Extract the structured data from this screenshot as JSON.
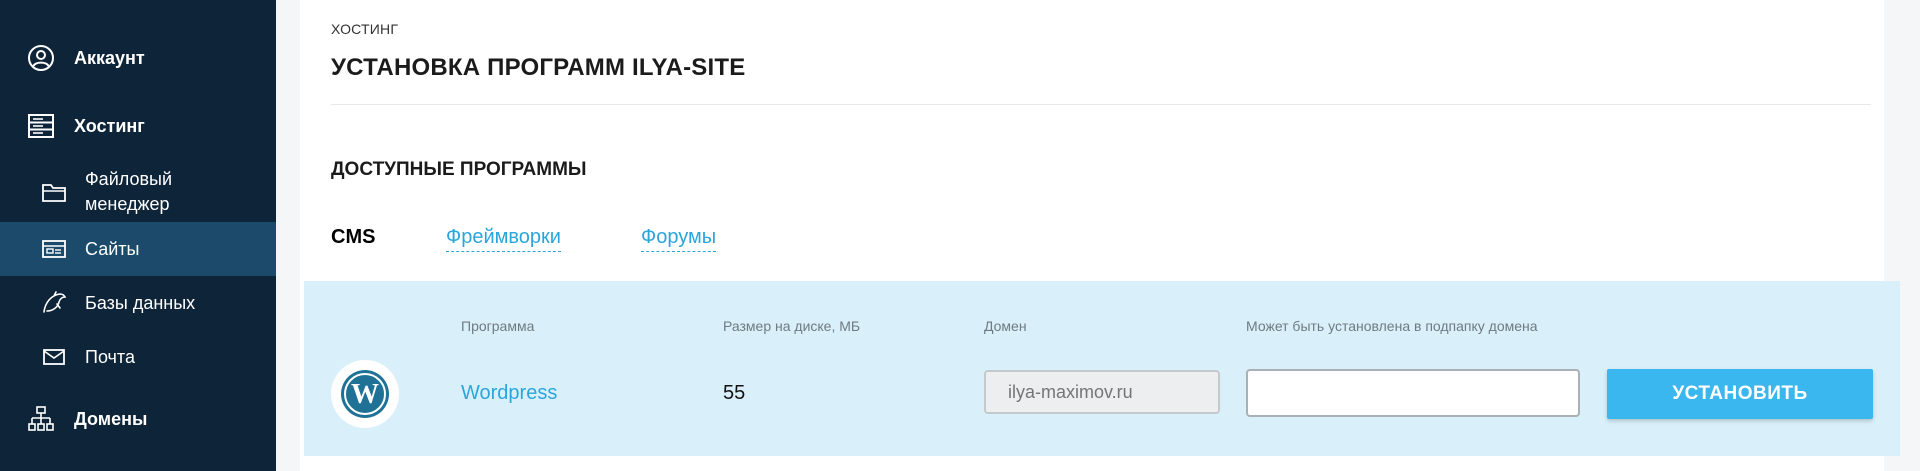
{
  "sidebar": {
    "items": [
      {
        "label": "Аккаунт",
        "icon": "user-circle-icon"
      },
      {
        "label": "Хостинг",
        "icon": "server-icon"
      },
      {
        "label": "Файловый менеджер",
        "icon": "folder-icon"
      },
      {
        "label": "Сайты",
        "icon": "site-card-icon"
      },
      {
        "label": "Базы данных",
        "icon": "dolphin-icon"
      },
      {
        "label": "Почта",
        "icon": "envelope-icon"
      },
      {
        "label": "Домены",
        "icon": "sitemap-icon"
      }
    ]
  },
  "breadcrumb": "ХОСТИНГ",
  "page": {
    "title": "УСТАНОВКА ПРОГРАММ ILYA-SITE",
    "section_title": "ДОСТУПНЫЕ ПРОГРАММЫ"
  },
  "tabs": [
    {
      "label": "CMS",
      "active": true
    },
    {
      "label": "Фреймворки",
      "active": false
    },
    {
      "label": "Форумы",
      "active": false
    }
  ],
  "table": {
    "headers": [
      "Программа",
      "Размер на диске, МБ",
      "Домен",
      "Может быть установлена в подпапку домена"
    ],
    "row": {
      "program": "Wordpress",
      "size": "55",
      "domain_placeholder": "ilya-maximov.ru",
      "subfolder_value": "",
      "button_label": "УСТАНОВИТЬ",
      "logo_icon": "wordpress-icon"
    }
  },
  "colors": {
    "sidebar_bg": "#0e2438",
    "sidebar_active": "#1c4a6b",
    "accent": "#2aa6dd",
    "button": "#3ab7ee",
    "row_bg": "#d9f0fa"
  }
}
